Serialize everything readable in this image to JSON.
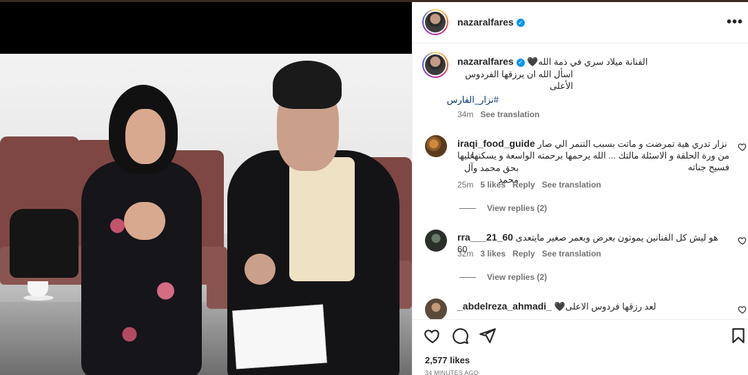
{
  "post": {
    "username": "nazaralfares",
    "more_label": "•••",
    "caption_line1": "الفنانة ميلاد سري في ذمة الله🖤",
    "caption_line2": "اسأل الله ان يرزقها الفردوس الأعلى",
    "hashtag": "#نزار_الفارس",
    "caption_time": "34m",
    "see_translation": "See translation",
    "likes": "2,577 likes",
    "posted": "34 MINUTES AGO"
  },
  "comments": [
    {
      "username": "iraqi_food_guide",
      "line1": "نزار تدري هية تمرضت و ماتت بسبب التنمر الي صار عليها",
      "line2": "من ورة الحلقة و الاسئلة مالتك ... الله يرحمها برحمته الواسعة و يسكنها فسيح جناته",
      "line3": "بحق محمد وآل محمد",
      "time": "25m",
      "likes": "5 likes",
      "reply": "Reply",
      "see_translation": "See translation",
      "view_replies": "View replies (2)"
    },
    {
      "username": "rra___21_60",
      "line1": "هو ليش كل الفنانين يموتون بعرض وبعمر صغير مايتعدى 60",
      "time": "32m",
      "likes": "3 likes",
      "reply": "Reply",
      "see_translation": "See translation",
      "view_replies": "View replies (2)"
    },
    {
      "username": "_abdelreza_ahmadi_",
      "line1": "لعد رزقها فردوس الاعلى🖤"
    }
  ],
  "colors": {
    "verified": "#0095f6",
    "link": "#00376b",
    "secondary_text": "#737373"
  }
}
